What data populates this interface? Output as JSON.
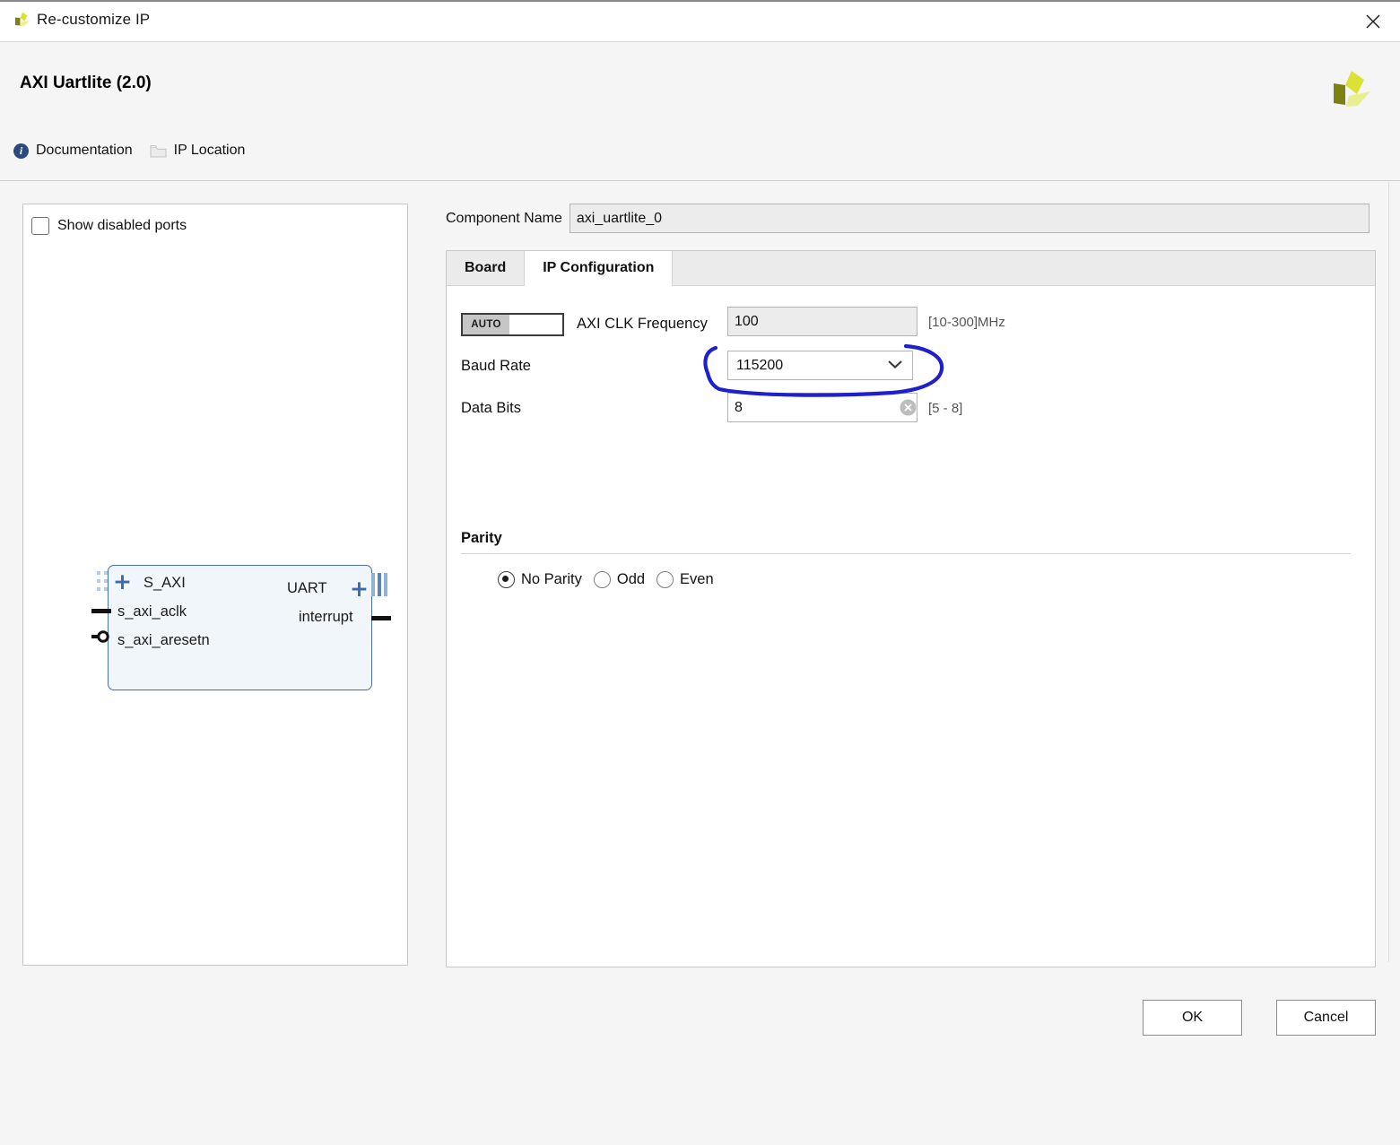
{
  "window": {
    "title": "Re-customize IP",
    "app_icon": "xilinx-logo-icon",
    "close_icon": "close-icon"
  },
  "header": {
    "ip_title": "AXI Uartlite (2.0)",
    "vendor_logo": "xilinx-logo-icon",
    "links": [
      {
        "label": "Documentation",
        "icon": "info-icon"
      },
      {
        "label": "IP Location",
        "icon": "folder-icon"
      }
    ]
  },
  "preview": {
    "show_disabled_ports_label": "Show disabled ports",
    "show_disabled_ports_checked": false,
    "diagram": {
      "left_ports": [
        {
          "name": "S_AXI",
          "type": "bus"
        },
        {
          "name": "s_axi_aclk",
          "type": "clock"
        },
        {
          "name": "s_axi_aresetn",
          "type": "reset-n"
        }
      ],
      "right_ports": [
        {
          "name": "UART",
          "type": "bus"
        },
        {
          "name": "interrupt",
          "type": "signal"
        }
      ]
    }
  },
  "config": {
    "component_name_label": "Component Name",
    "component_name_value": "axi_uartlite_0",
    "tabs": [
      {
        "label": "Board",
        "active": false
      },
      {
        "label": "IP Configuration",
        "active": true
      }
    ],
    "fields": {
      "auto_toggle_label": "AUTO",
      "axi_clk_label": "AXI CLK Frequency",
      "axi_clk_value": "100",
      "axi_clk_range": "[10-300]MHz",
      "baud_rate_label": "Baud Rate",
      "baud_rate_value": "115200",
      "data_bits_label": "Data Bits",
      "data_bits_value": "8",
      "data_bits_range": "[5 - 8]",
      "clear_icon": "clear-circle-x-icon",
      "chevron_icon": "chevron-down-icon"
    },
    "parity": {
      "heading": "Parity",
      "options": [
        {
          "label": "No Parity",
          "selected": true
        },
        {
          "label": "Odd",
          "selected": false
        },
        {
          "label": "Even",
          "selected": false
        }
      ]
    }
  },
  "footer": {
    "ok_label": "OK",
    "cancel_label": "Cancel"
  },
  "annotation": {
    "shape": "hand-drawn-oval",
    "color": "#1f1fd0",
    "target": "baud-rate-combo"
  }
}
